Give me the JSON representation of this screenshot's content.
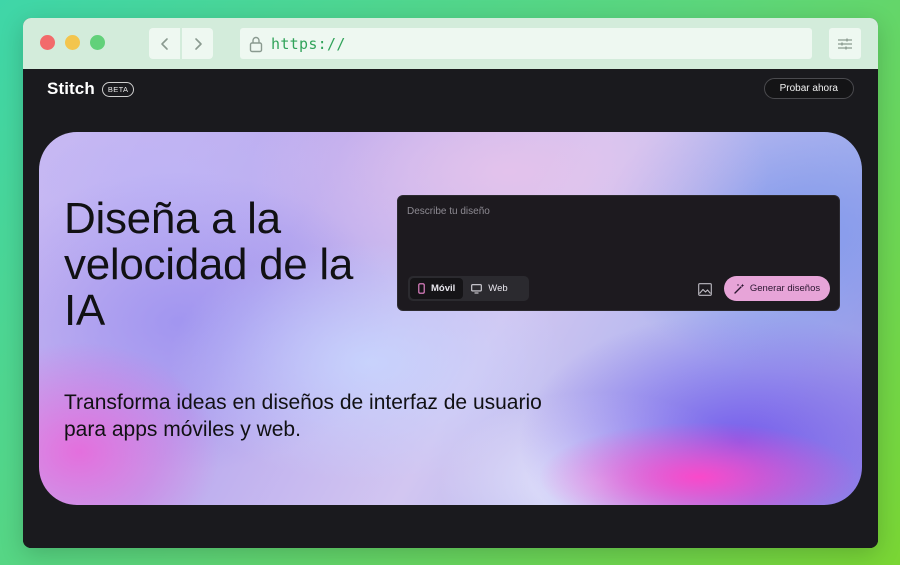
{
  "browser": {
    "url": "https://",
    "icons": {
      "back": "chevron-left-icon",
      "forward": "chevron-right-icon",
      "lock": "lock-icon",
      "menu": "sliders-icon"
    }
  },
  "header": {
    "brand": "Stitch",
    "badge": "BETA",
    "cta_label": "Probar ahora"
  },
  "hero": {
    "title": "Diseña a la velocidad de la IA",
    "subtitle": "Transforma ideas en diseños de interfaz de usuario para apps móviles y web."
  },
  "prompt": {
    "placeholder": "Describe tu diseño",
    "modes": [
      {
        "label": "Móvil",
        "icon": "phone-icon",
        "selected": true
      },
      {
        "label": "Web",
        "icon": "monitor-icon",
        "selected": false
      }
    ],
    "image_icon": "image-icon",
    "generate_label": "Generar diseños",
    "generate_icon": "magic-wand-icon"
  },
  "colors": {
    "page_bg": "#1a1a1e",
    "generate_button": "#e7a4d8",
    "url_text": "#31a35a"
  }
}
